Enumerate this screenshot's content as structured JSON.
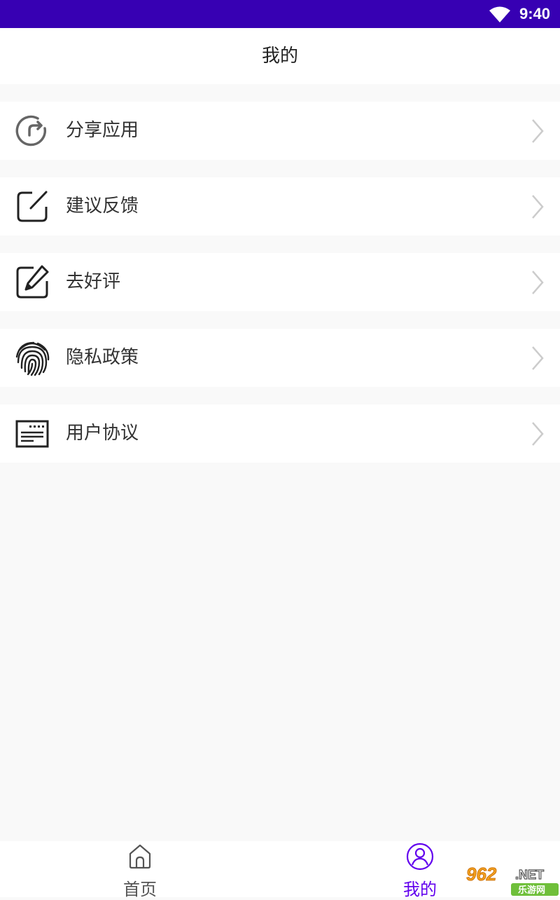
{
  "status_bar": {
    "time": "9:40",
    "wifi_icon": "wifi-icon"
  },
  "header": {
    "title": "我的"
  },
  "menu": {
    "items": [
      {
        "label": "分享应用",
        "icon": "share-icon"
      },
      {
        "label": "建议反馈",
        "icon": "feedback-edit-icon"
      },
      {
        "label": "去好评",
        "icon": "rate-pencil-icon"
      },
      {
        "label": "隐私政策",
        "icon": "fingerprint-icon"
      },
      {
        "label": "用户协议",
        "icon": "agreement-document-icon"
      }
    ]
  },
  "bottom_nav": {
    "tabs": [
      {
        "label": "首页",
        "icon": "home-icon",
        "active": false
      },
      {
        "label": "我的",
        "icon": "profile-icon",
        "active": true
      }
    ]
  },
  "watermark": {
    "text": "962.NET",
    "subtext": "乐游网"
  },
  "colors": {
    "status_bar": "#3700b3",
    "accent": "#6200ee",
    "background": "#f9f9f9"
  }
}
